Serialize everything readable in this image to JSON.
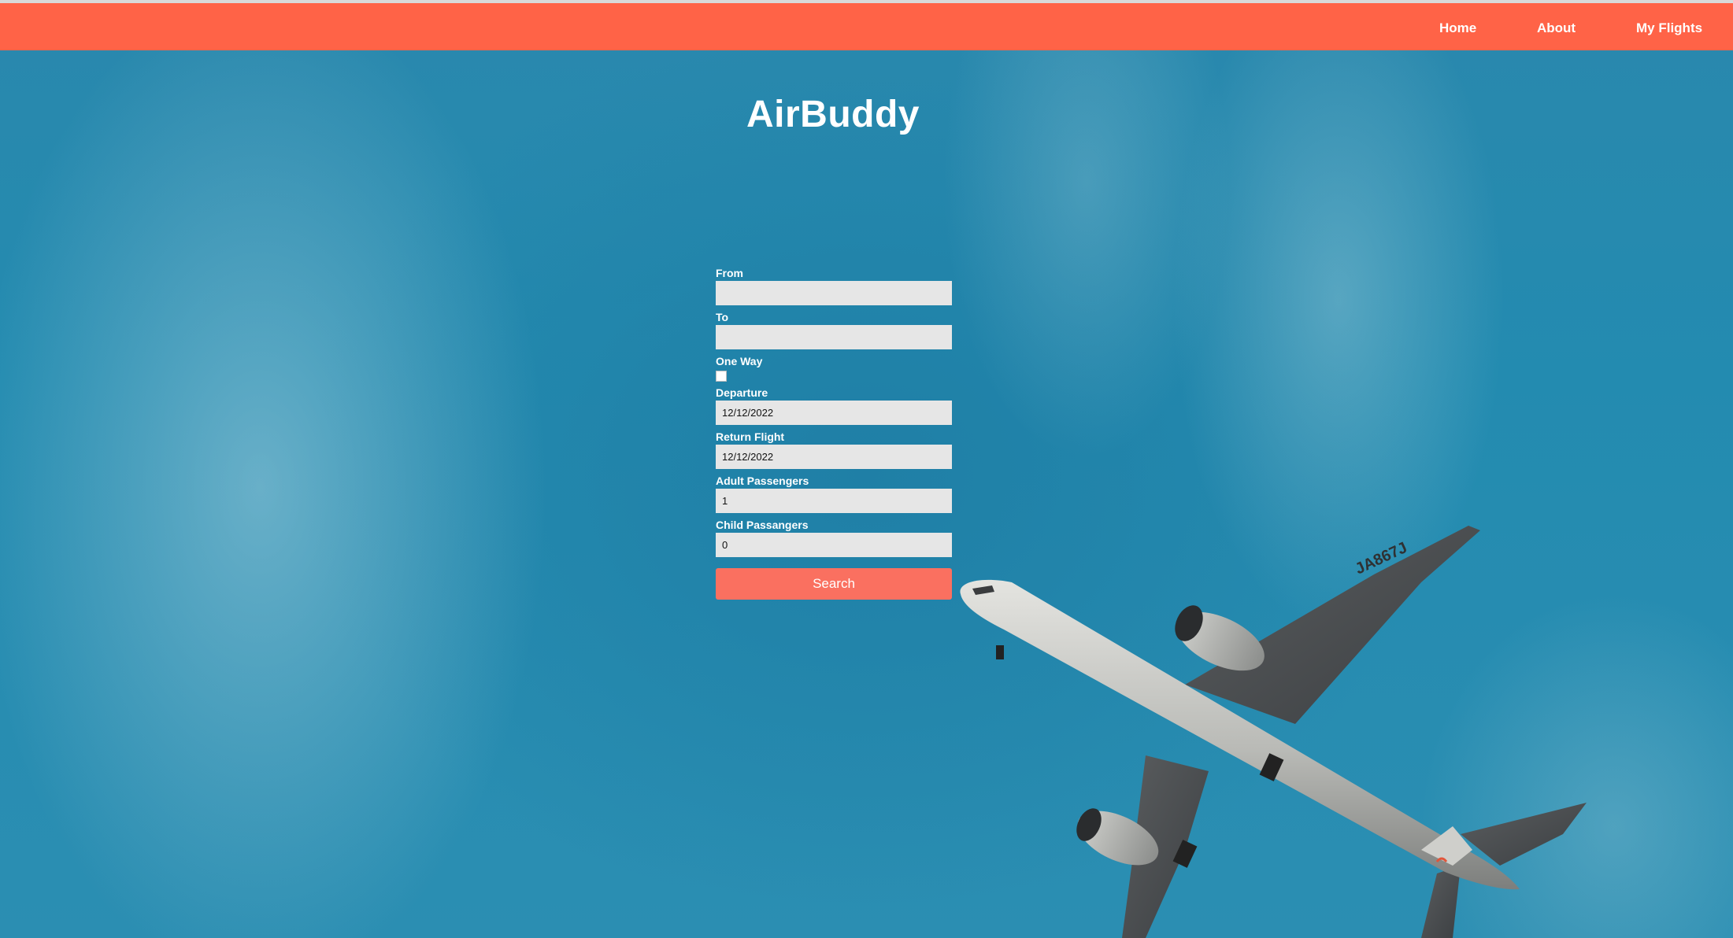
{
  "nav": {
    "items": [
      {
        "label": "Home"
      },
      {
        "label": "About"
      },
      {
        "label": "My Flights"
      }
    ]
  },
  "header": {
    "title": "AirBuddy"
  },
  "form": {
    "from_label": "From",
    "from_value": "",
    "to_label": "To",
    "to_value": "",
    "one_way_label": "One Way",
    "one_way_checked": false,
    "departure_label": "Departure",
    "departure_value": "12/12/2022",
    "return_label": "Return Flight",
    "return_value": "12/12/2022",
    "adult_label": "Adult Passengers",
    "adult_value": "1",
    "child_label": "Child Passangers",
    "child_value": "0",
    "search_label": "Search"
  },
  "background": {
    "plane_registration": "JA867J"
  },
  "colors": {
    "navbar": "#ff6347",
    "button": "#fa7060",
    "sky": "#2a88ad",
    "input_bg": "#e6e6e6"
  }
}
